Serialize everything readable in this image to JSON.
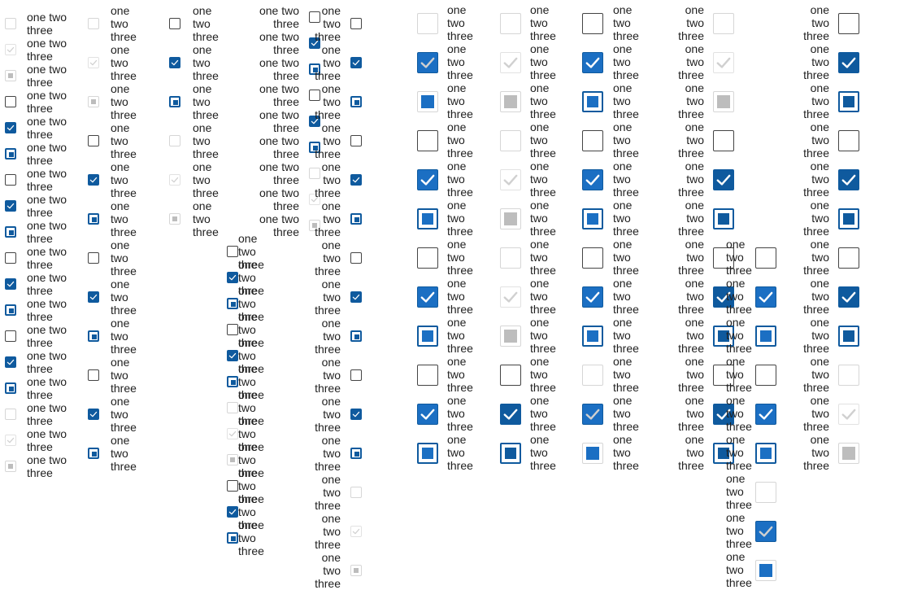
{
  "label_one_line": "one two\nthree",
  "label_stacked": "one\ntwo\nthree",
  "colors": {
    "accent": "#0f5a9e",
    "accent_alt": "#1b6fc3",
    "border": "#444444",
    "disabled": "#d6d6d6"
  },
  "columns": [
    {
      "states": [
        "dis-unchecked",
        "dis-checked",
        "dis-indet",
        "unchecked",
        "checked",
        "indet",
        "unchecked",
        "checked",
        "indet",
        "unchecked",
        "checked",
        "indet",
        "unchecked",
        "checked",
        "indet",
        "dis-unchecked",
        "dis-checked",
        "dis-indet"
      ]
    },
    {
      "states": [
        "dis-unchecked",
        "dis-checked",
        "dis-indet",
        "unchecked",
        "checked",
        "indet",
        "unchecked",
        "checked",
        "indet",
        "unchecked",
        "checked",
        "indet"
      ]
    },
    {
      "states": [
        "unchecked",
        "checked",
        "indet",
        "dis-unchecked",
        "dis-checked",
        "dis-indet"
      ]
    },
    {
      "states": [
        "unchecked",
        "checked",
        "indet",
        "unchecked",
        "checked",
        "indet",
        "dis-unchecked",
        "dis-checked",
        "dis-indet"
      ]
    },
    {
      "states": [
        "unchecked",
        "checked",
        "indet",
        "unchecked",
        "checked",
        "indet",
        "dis-unchecked",
        "dis-checked",
        "dis-indet",
        "unchecked",
        "checked",
        "indet"
      ]
    },
    {
      "states": [
        "unchecked",
        "checked",
        "indet",
        "unchecked",
        "checked",
        "indet",
        "unchecked",
        "checked",
        "indet",
        "unchecked",
        "checked",
        "indet",
        "dis-unchecked",
        "dis-checked",
        "dis-indet"
      ]
    },
    {
      "states": [
        "dis-unchecked",
        "dis-checked",
        "dis-indet",
        "unchecked",
        "checked",
        "indet",
        "unchecked",
        "checked",
        "indet",
        "unchecked",
        "checked",
        "indet"
      ]
    },
    {
      "states": [
        "dis-unchecked",
        "dis-checked",
        "dis-indet",
        "dis-unchecked",
        "dis-checked",
        "dis-indet",
        "dis-unchecked",
        "dis-checked",
        "dis-indet",
        "unchecked",
        "checked",
        "indet"
      ]
    },
    {
      "states": [
        "unchecked",
        "checked",
        "indet",
        "unchecked",
        "checked",
        "indet",
        "unchecked",
        "checked",
        "indet",
        "dis-unchecked",
        "dis-checked",
        "dis-indet"
      ]
    },
    {
      "states": [
        "dis-unchecked",
        "dis-checked",
        "dis-indet",
        "unchecked",
        "checked",
        "indet",
        "unchecked",
        "checked",
        "indet",
        "unchecked",
        "checked",
        "indet"
      ]
    },
    {
      "states": [
        "unchecked",
        "checked",
        "indet",
        "unchecked",
        "checked",
        "indet",
        "dis-unchecked",
        "dis-checked",
        "dis-indet"
      ]
    },
    {
      "states": [
        "unchecked",
        "checked",
        "indet",
        "unchecked",
        "checked",
        "indet",
        "unchecked",
        "checked",
        "indet",
        "dis-unchecked",
        "dis-checked",
        "dis-indet"
      ]
    }
  ]
}
